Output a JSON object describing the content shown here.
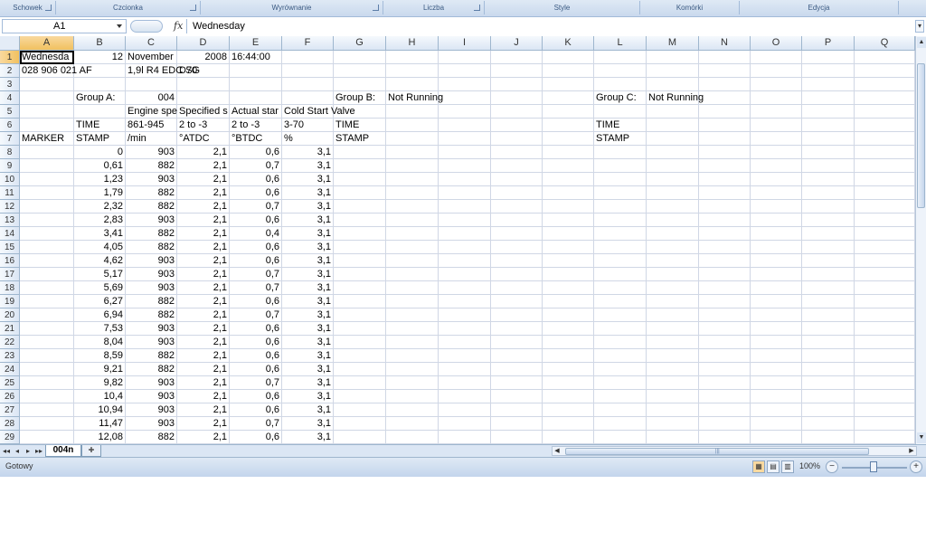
{
  "ribbon": {
    "groups": [
      {
        "label": "Schowek",
        "launcher": true
      },
      {
        "label": "Czcionka",
        "launcher": true
      },
      {
        "label": "Wyrównanie",
        "launcher": true
      },
      {
        "label": "Liczba",
        "launcher": true
      },
      {
        "label": "Style",
        "launcher": false
      },
      {
        "label": "Komórki",
        "launcher": false
      },
      {
        "label": "Edycja",
        "launcher": false
      }
    ]
  },
  "formula_bar": {
    "name_box": "A1",
    "fx": "fx",
    "content": "Wednesday"
  },
  "grid": {
    "columns": [
      "A",
      "B",
      "C",
      "D",
      "E",
      "F",
      "G",
      "H",
      "I",
      "J",
      "K",
      "L",
      "M",
      "N",
      "O",
      "P",
      "Q"
    ],
    "selected_column": "A",
    "selected_row": "1",
    "rows": [
      {
        "n": "1",
        "cells": {
          "A": "Wednesda",
          "B": "12",
          "C": "November",
          "D": "2008",
          "E": "16:44:00"
        }
      },
      {
        "n": "2",
        "cells": {
          "A": "028 906 021 AF",
          "C": "1,9l R4 EDC SG",
          "D": "D70"
        }
      },
      {
        "n": "3",
        "cells": {}
      },
      {
        "n": "4",
        "cells": {
          "B": "Group A:",
          "C": "004",
          "G": "Group B:",
          "H": "Not Running",
          "L": "Group C:",
          "M": "Not Running"
        }
      },
      {
        "n": "5",
        "cells": {
          "C": "Engine spe",
          "D": "Specified s",
          "E": "Actual star",
          "F": "Cold Start Valve"
        }
      },
      {
        "n": "6",
        "cells": {
          "B": "TIME",
          "C": "861-945",
          "D": "2 to -3",
          "E": "2 to -3",
          "F": "3-70",
          "G": "TIME",
          "L": "TIME"
        }
      },
      {
        "n": "7",
        "cells": {
          "A": "MARKER",
          "B": "STAMP",
          "C": "/min",
          "D": "°ATDC",
          "E": "°BTDC",
          "F": "%",
          "G": "STAMP",
          "L": "STAMP"
        }
      },
      {
        "n": "8",
        "cells": {
          "B": "0",
          "C": "903",
          "D": "2,1",
          "E": "0,6",
          "F": "3,1"
        }
      },
      {
        "n": "9",
        "cells": {
          "B": "0,61",
          "C": "882",
          "D": "2,1",
          "E": "0,7",
          "F": "3,1"
        }
      },
      {
        "n": "10",
        "cells": {
          "B": "1,23",
          "C": "903",
          "D": "2,1",
          "E": "0,6",
          "F": "3,1"
        }
      },
      {
        "n": "11",
        "cells": {
          "B": "1,79",
          "C": "882",
          "D": "2,1",
          "E": "0,6",
          "F": "3,1"
        }
      },
      {
        "n": "12",
        "cells": {
          "B": "2,32",
          "C": "882",
          "D": "2,1",
          "E": "0,7",
          "F": "3,1"
        }
      },
      {
        "n": "13",
        "cells": {
          "B": "2,83",
          "C": "903",
          "D": "2,1",
          "E": "0,6",
          "F": "3,1"
        }
      },
      {
        "n": "14",
        "cells": {
          "B": "3,41",
          "C": "882",
          "D": "2,1",
          "E": "0,4",
          "F": "3,1"
        }
      },
      {
        "n": "15",
        "cells": {
          "B": "4,05",
          "C": "882",
          "D": "2,1",
          "E": "0,6",
          "F": "3,1"
        }
      },
      {
        "n": "16",
        "cells": {
          "B": "4,62",
          "C": "903",
          "D": "2,1",
          "E": "0,6",
          "F": "3,1"
        }
      },
      {
        "n": "17",
        "cells": {
          "B": "5,17",
          "C": "903",
          "D": "2,1",
          "E": "0,7",
          "F": "3,1"
        }
      },
      {
        "n": "18",
        "cells": {
          "B": "5,69",
          "C": "903",
          "D": "2,1",
          "E": "0,7",
          "F": "3,1"
        }
      },
      {
        "n": "19",
        "cells": {
          "B": "6,27",
          "C": "882",
          "D": "2,1",
          "E": "0,6",
          "F": "3,1"
        }
      },
      {
        "n": "20",
        "cells": {
          "B": "6,94",
          "C": "882",
          "D": "2,1",
          "E": "0,7",
          "F": "3,1"
        }
      },
      {
        "n": "21",
        "cells": {
          "B": "7,53",
          "C": "903",
          "D": "2,1",
          "E": "0,6",
          "F": "3,1"
        }
      },
      {
        "n": "22",
        "cells": {
          "B": "8,04",
          "C": "903",
          "D": "2,1",
          "E": "0,6",
          "F": "3,1"
        }
      },
      {
        "n": "23",
        "cells": {
          "B": "8,59",
          "C": "882",
          "D": "2,1",
          "E": "0,6",
          "F": "3,1"
        }
      },
      {
        "n": "24",
        "cells": {
          "B": "9,21",
          "C": "882",
          "D": "2,1",
          "E": "0,6",
          "F": "3,1"
        }
      },
      {
        "n": "25",
        "cells": {
          "B": "9,82",
          "C": "903",
          "D": "2,1",
          "E": "0,7",
          "F": "3,1"
        }
      },
      {
        "n": "26",
        "cells": {
          "B": "10,4",
          "C": "903",
          "D": "2,1",
          "E": "0,6",
          "F": "3,1"
        }
      },
      {
        "n": "27",
        "cells": {
          "B": "10,94",
          "C": "903",
          "D": "2,1",
          "E": "0,6",
          "F": "3,1"
        }
      },
      {
        "n": "28",
        "cells": {
          "B": "11,47",
          "C": "903",
          "D": "2,1",
          "E": "0,7",
          "F": "3,1"
        }
      },
      {
        "n": "29",
        "cells": {
          "B": "12,08",
          "C": "882",
          "D": "2,1",
          "E": "0,6",
          "F": "3,1"
        }
      }
    ],
    "numeric_columns": [
      "B",
      "C",
      "D",
      "E",
      "F"
    ]
  },
  "sheet_tabs": {
    "active": "004n",
    "nav_buttons": [
      "◂◂",
      "◂",
      "▸",
      "▸▸"
    ]
  },
  "status_bar": {
    "status": "Gotowy",
    "zoom": "100%",
    "zoom_out": "−",
    "zoom_in": "+"
  },
  "colors": {
    "ribbon_bg": "#c9d9ed",
    "header_selected": "#f1c15f",
    "gridline": "#d0d7e5"
  }
}
